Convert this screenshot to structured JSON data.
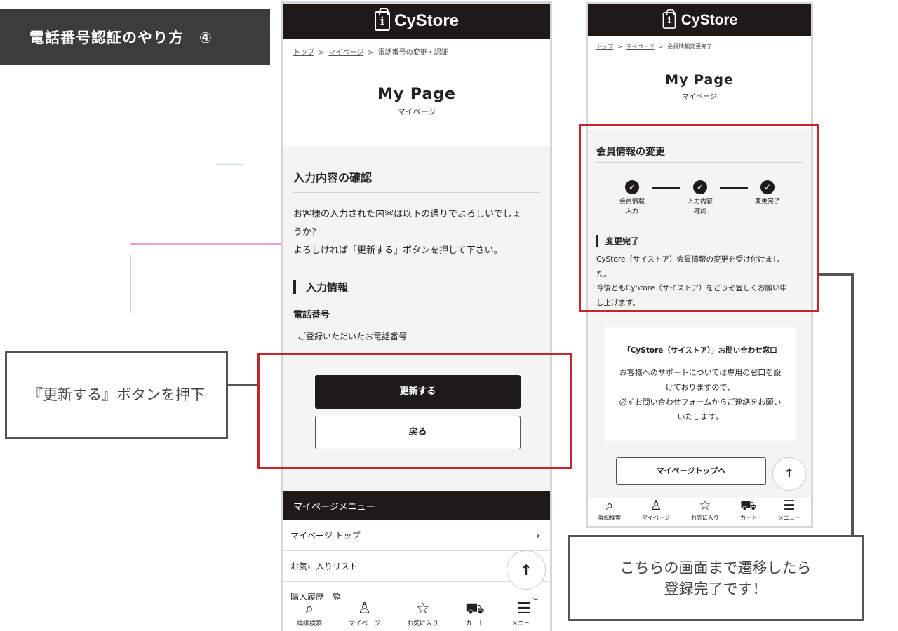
{
  "banner": {
    "title": "電話番号認証のやり方　④"
  },
  "brand": "CyStore",
  "phone1": {
    "breadcrumb": {
      "top": "トップ",
      "mypage": "マイページ",
      "current": "電話番号の変更・認証"
    },
    "page_title": "My Page",
    "page_subtitle": "マイページ",
    "section_title": "入力内容の確認",
    "message_line1": "お客様の入力された内容は以下の通りでよろしいでしょ",
    "message_line2": "うか？",
    "message_line3": "よろしければ「更新する」ボタンを押して下さい。",
    "input_section": "入力情報",
    "phone_label": "電話番号",
    "phone_value": "ご登録いただいたお電話番号",
    "update_button": "更新する",
    "back_button": "戻る",
    "menu_title": "マイページメニュー",
    "menu_items": [
      "マイページ トップ",
      "お気に入りリスト",
      "購入履歴一覧"
    ]
  },
  "phone2": {
    "breadcrumb": {
      "top": "トップ",
      "mypage": "マイページ",
      "current": "会員情報変更完了"
    },
    "page_title": "My Page",
    "page_subtitle": "マイページ",
    "section_title": "会員情報の変更",
    "steps": [
      {
        "l1": "会員情報",
        "l2": "入力"
      },
      {
        "l1": "入力内容",
        "l2": "確認"
      },
      {
        "l1": "変更完了",
        "l2": ""
      }
    ],
    "complete_title": "変更完了",
    "complete_line1": "CyStore（サイストア）会員情報の変更を受け付けまし",
    "complete_line2": "た。",
    "complete_line3": "今後ともCyStore（サイストア）をどうぞ宜しくお願い申",
    "complete_line4": "し上げます。",
    "contact_title": "「CyStore（サイストア）」お問い合わせ窓口",
    "contact_line1": "お客様へのサポートについては専用の窓口を設",
    "contact_line2": "けておりますので、",
    "contact_line3": "必ずお問い合わせフォームからご連絡をお願い",
    "contact_line4": "いたします。",
    "mypage_top_button": "マイページトップへ"
  },
  "tabbar": [
    {
      "icon": "search-icon",
      "label": "詳細検索"
    },
    {
      "icon": "user-icon",
      "label": "マイページ"
    },
    {
      "icon": "star-icon",
      "label": "お気に入り"
    },
    {
      "icon": "cart-icon",
      "label": "カート"
    },
    {
      "icon": "menu-icon",
      "label": "メニュー"
    }
  ],
  "callouts": {
    "press_update": "『更新する』ボタンを押下",
    "done_line1": "こちらの画面まで遷移したら",
    "done_line2": "登録完了です！"
  },
  "colors": {
    "highlight": "#c1272d",
    "header": "#1d1a18",
    "banner": "#3c3c3c"
  }
}
